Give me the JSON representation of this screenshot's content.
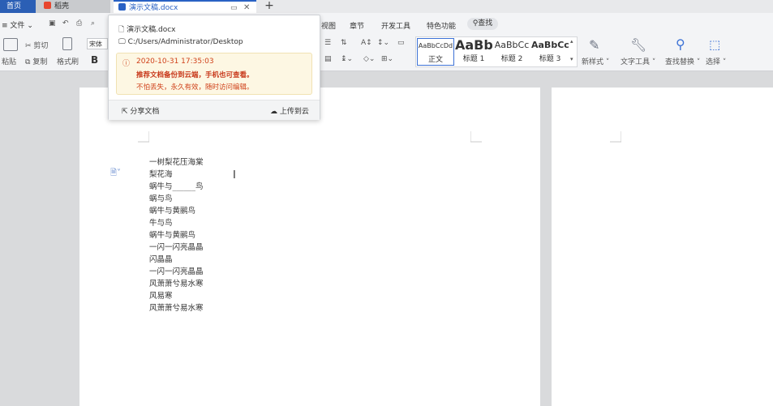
{
  "tabs": {
    "home": "首页",
    "daoke": "稻壳",
    "doc": "演示文稿.docx",
    "add": "+"
  },
  "menubar": {
    "file": "文件",
    "left_items": [
      "视图",
      "章节",
      "开发工具",
      "特色功能"
    ],
    "search": "查找"
  },
  "ribbon": {
    "paste": "粘贴",
    "cut": "剪切",
    "copy": "复制",
    "format_painter": "格式刷",
    "font": "宋体",
    "bold": "B",
    "styles": [
      {
        "sample": "AaBbCcDd",
        "label": "正文"
      },
      {
        "sample": "AaBb",
        "label": "标题 1"
      },
      {
        "sample": "AaBbCc",
        "label": "标题 2"
      },
      {
        "sample": "AaBbCc",
        "label": "标题 3"
      }
    ],
    "new_style": "新样式",
    "text_tools": "文字工具",
    "find_replace": "查找替换",
    "select": "选择"
  },
  "popup": {
    "filename": "演示文稿.docx",
    "path": "C:/Users/Administrator/Desktop",
    "time": "2020-10-31 17:35:03",
    "recommend": "推荐文档备份到云端，手机也可查看。",
    "sub": "不怕丢失，永久有效，随时访问编辑。",
    "share": "分享文档",
    "upload": "上传到云"
  },
  "document": {
    "lines": [
      "一树梨花压海棠",
      "梨花海",
      "蜗牛与______鸟",
      "蜗与鸟",
      "蜗牛与黄鹂鸟",
      "牛与鸟",
      "蜗牛与黄鹂鸟",
      "一闪一闪亮晶晶",
      "闪晶晶",
      "一闪一闪亮晶晶",
      "风萧萧兮易水寒",
      "风易寒",
      "风萧萧兮易水寒"
    ]
  },
  "colors": {
    "accent": "#2a62c4",
    "home_tab": "#2b5fb5",
    "warning": "#d0421b"
  }
}
